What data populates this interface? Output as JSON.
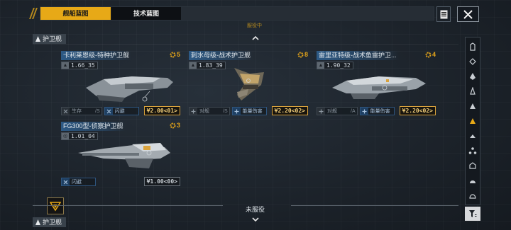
{
  "tabs": [
    {
      "label": "舰船蓝图",
      "active": true
    },
    {
      "label": "技术蓝图",
      "active": false
    }
  ],
  "subheader": "服役中",
  "category_top": "护卫舰",
  "category_bottom": "护卫舰",
  "bottom_title": "未服役",
  "ships": [
    {
      "name": "卡利莱恩级-特种护卫舰",
      "stars": "5",
      "stat": "1.66_35",
      "tags": [
        {
          "icon": "x",
          "label": "生存",
          "suffix": "S",
          "style": "gray"
        },
        {
          "icon": "x",
          "label": "闪避",
          "suffix": "",
          "style": "blue"
        }
      ],
      "price": "¥2.00<01>",
      "price_style": "gold"
    },
    {
      "name": "刺水母级-战术护卫舰",
      "stars": "8",
      "stat": "1.83_39",
      "tags": [
        {
          "icon": "+",
          "label": "对舰",
          "suffix": "S",
          "style": "gray"
        },
        {
          "icon": "+",
          "label": "能量伤害",
          "suffix": "",
          "style": "blue"
        }
      ],
      "price": "¥2.20<02>",
      "price_style": "gold"
    },
    {
      "name": "雷里亚特级-战术鱼雷护卫...",
      "stars": "4",
      "stat": "1.90_32",
      "tags": [
        {
          "icon": "+",
          "label": "对舰",
          "suffix": "A",
          "style": "gray"
        },
        {
          "icon": "+",
          "label": "能量伤害",
          "suffix": "",
          "style": "blue"
        }
      ],
      "price": "¥2.20<02>",
      "price_style": "gold"
    },
    {
      "name": "FG300型-侦察护卫舰",
      "stars": "3",
      "stat": "1.01_04",
      "tags": [
        {
          "icon": "x",
          "label": "闪避",
          "suffix": "",
          "style": "blue"
        }
      ],
      "price": "¥1.00<00>",
      "price_style": "plain"
    }
  ],
  "rail_icons": [
    "carrier-icon",
    "cruiser-icon",
    "destroyer-icon",
    "light-ship-icon",
    "frigate-icon",
    "frigate-selected-icon",
    "corvette-icon",
    "fighter-group-icon",
    "station-icon",
    "dome-icon",
    "cargo-icon"
  ],
  "colors": {
    "accent": "#e7a917",
    "tag_blue": "#2e557e",
    "name_bg": "#2d5a86"
  }
}
